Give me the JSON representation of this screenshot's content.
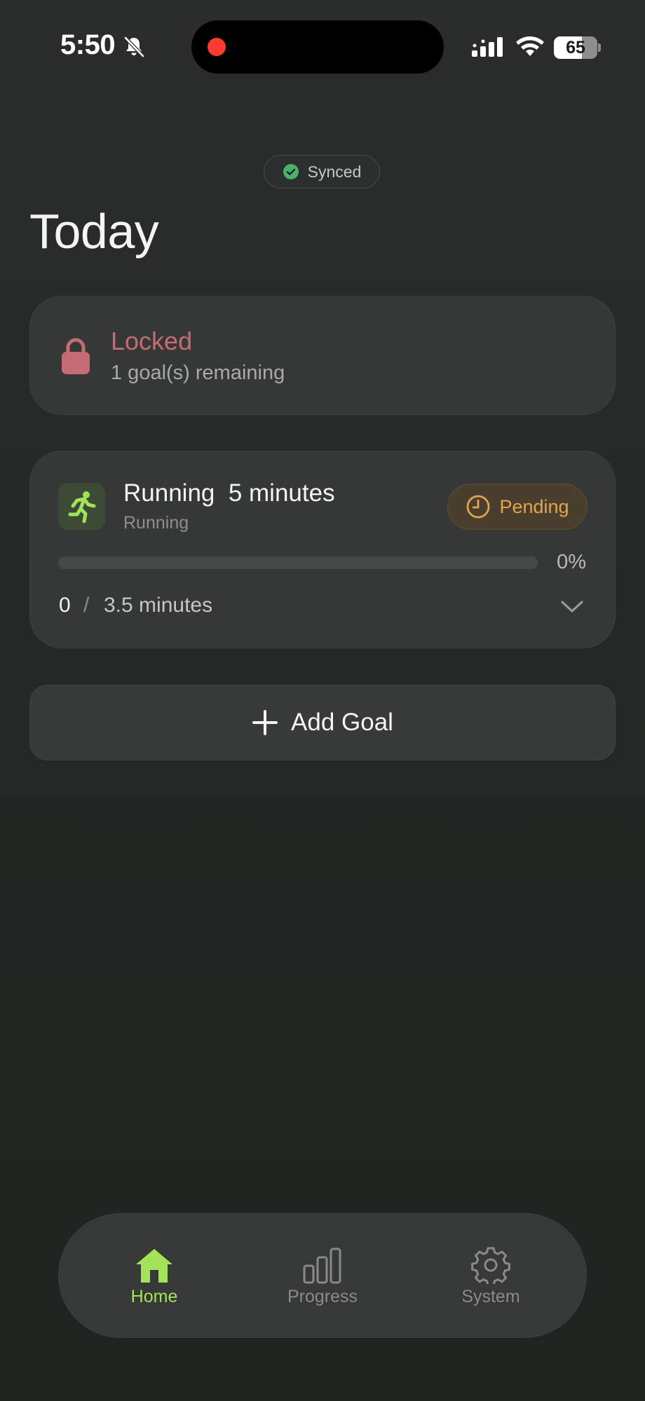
{
  "status_bar": {
    "time": "5:50",
    "battery": "65",
    "battery_level": 0.65,
    "icons": [
      "bell-slash-icon",
      "cellular-signal-icon",
      "wifi-icon",
      "battery-icon"
    ]
  },
  "sync": {
    "label": "Synced",
    "icon": "checkmark-circle-icon",
    "color": "#4caf6a"
  },
  "page": {
    "title": "Today"
  },
  "lock_card": {
    "title": "Locked",
    "subtitle": "1 goal(s) remaining",
    "icon": "lock-icon",
    "color": "#c46b73"
  },
  "goals": [
    {
      "title": "Running  5 minutes",
      "subtitle": "Running",
      "icon": "running-person-icon",
      "status": "Pending",
      "status_icon": "clock-icon",
      "status_color": "#e3a44b",
      "progress": 0,
      "percent_label": "0%",
      "current": "0",
      "separator": "/",
      "target": "3.5 minutes"
    }
  ],
  "add_goal": {
    "label": "Add Goal",
    "icon": "plus-icon"
  },
  "tabs": [
    {
      "label": "Home",
      "icon": "home-icon",
      "active": true
    },
    {
      "label": "Progress",
      "icon": "bar-chart-icon",
      "active": false
    },
    {
      "label": "System",
      "icon": "gear-icon",
      "active": false
    }
  ],
  "colors": {
    "accent": "#a3e35a",
    "background": "#232725",
    "card": "#363837"
  }
}
